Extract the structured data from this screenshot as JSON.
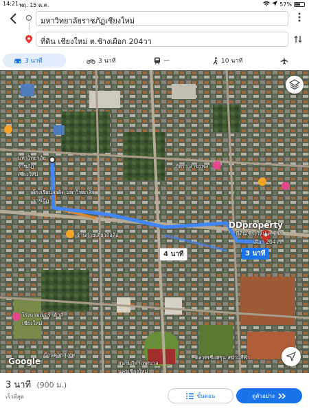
{
  "status_bar": {
    "time": "14:21",
    "date": "พฤ. 15 ต.ค.",
    "battery": "57%"
  },
  "directions": {
    "origin": "มหาวิทยาลัยราชภัฏเชียงใหม่",
    "destination": "ที่ดิน เชียงใหม่ ต.ช้างเผือก 204วา"
  },
  "modes": [
    {
      "icon": "car-icon",
      "label": "3 นาที",
      "active": true
    },
    {
      "icon": "motorcycle-icon",
      "label": "3 นาที"
    },
    {
      "icon": "train-icon",
      "label": "—"
    },
    {
      "icon": "walk-icon",
      "label": "10 นาที"
    },
    {
      "icon": "flight-icon",
      "label": ""
    }
  ],
  "map": {
    "labels": [
      "มหาวิทยาลัยราชภัฏเชียงใหม่",
      "โรงเรียนสาธิต มหาวิทยาลัยราชภัฏ",
      "ร้านก๋วยเตี๋ยวล้อล้อ",
      "ภัทรา สาขาพล",
      "ที่ดินเชียงใหม่ ต.ช้างเผือก 204วา",
      "โรงแรมเมอริ เฮ้าส์ เชียงใหม่",
      "สนามกีฬาเทศบาล นครเชียงใหม่",
      "ตลาดเชื่อมรุน สนามกีฬา",
      "บ้านดอยสุเทพ"
    ],
    "route_tags": {
      "alt": "4 นาที",
      "main": "3 นาที"
    },
    "watermark": "DDproperty",
    "google_logo": "Google"
  },
  "bottom_sheet": {
    "duration": "3 นาที",
    "distance": "(900 ม.)",
    "subtitle": "เร็วที่สุด",
    "steps_label": "ขั้นตอน",
    "preview_label": "ดูตัวอย่าง"
  },
  "colors": {
    "accent": "#1a73e8",
    "route_main": "#4285f4",
    "route_alt": "#d48a3c"
  }
}
